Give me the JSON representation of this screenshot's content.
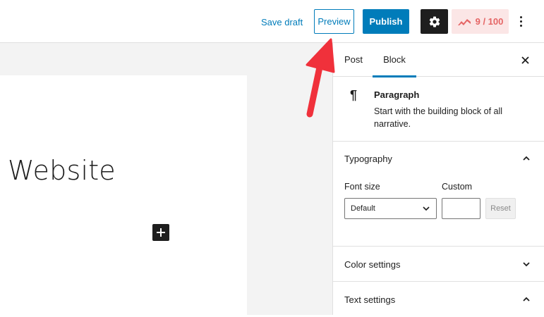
{
  "toolbar": {
    "save_draft_label": "Save draft",
    "preview_label": "Preview",
    "publish_label": "Publish",
    "settings_icon": "gear-icon",
    "score_text": "9 / 100",
    "score_icon": "seo-score-icon",
    "more_icon": "more-vertical-icon"
  },
  "editor": {
    "title_text": "Website",
    "add_block_icon": "plus-icon"
  },
  "sidebar": {
    "tabs": [
      {
        "label": "Post",
        "active": false
      },
      {
        "label": "Block",
        "active": true
      }
    ],
    "close_icon": "close-icon",
    "block": {
      "icon": "paragraph-icon",
      "name": "Paragraph",
      "description": "Start with the building block of all narrative."
    },
    "typography": {
      "title": "Typography",
      "expanded": true,
      "font_size_label": "Font size",
      "font_size_value": "Default",
      "custom_label": "Custom",
      "custom_value": "",
      "reset_label": "Reset"
    },
    "color_settings": {
      "title": "Color settings",
      "expanded": false
    },
    "text_settings": {
      "title": "Text settings",
      "expanded": true
    }
  },
  "colors": {
    "accent": "#007cba",
    "dark": "#1e1e1e",
    "score": "#e56565",
    "score_bg": "#fbe6e6",
    "annotation_arrow": "#f0313b"
  }
}
